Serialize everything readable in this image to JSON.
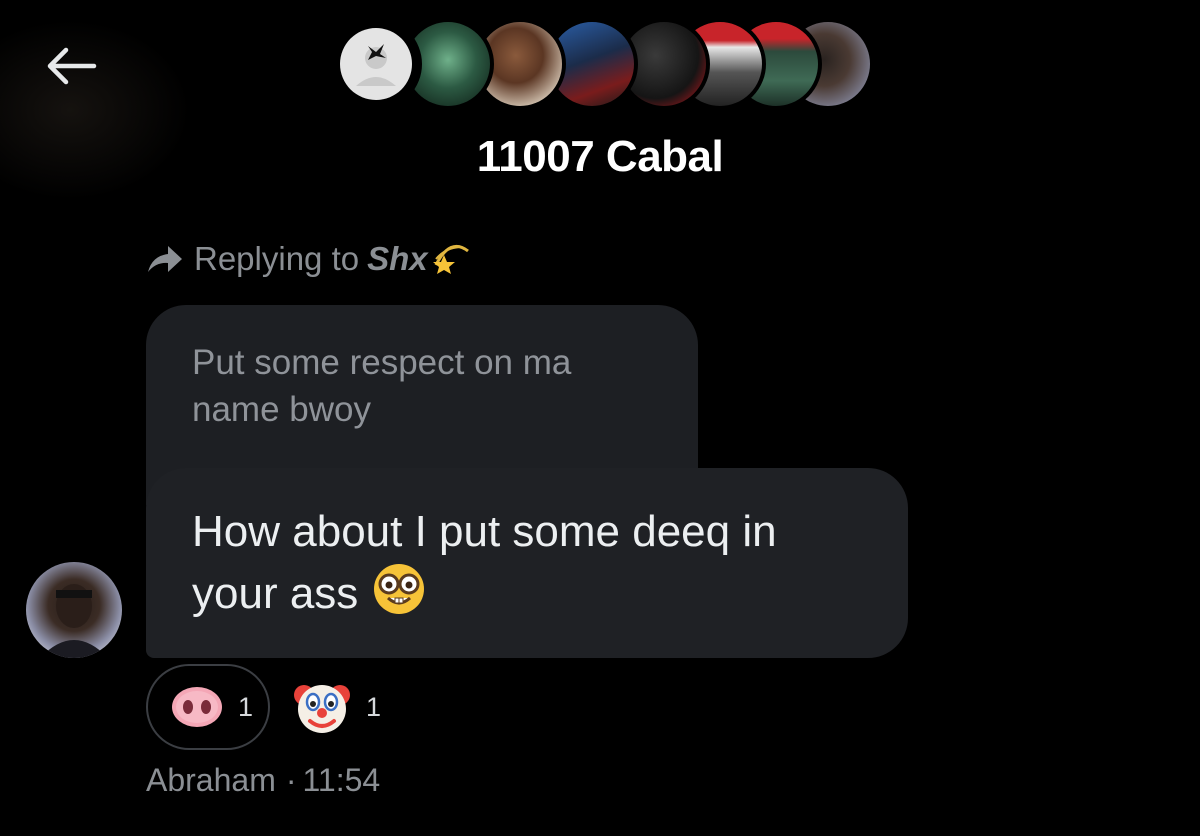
{
  "header": {
    "back_icon": "arrow-left-icon",
    "title": "11007 Cabal",
    "member_avatars": [
      "avatar-1",
      "avatar-2",
      "avatar-3",
      "avatar-4",
      "avatar-5",
      "avatar-6",
      "avatar-7",
      "avatar-8"
    ]
  },
  "reply": {
    "prefix": "Replying to",
    "name": "Shx",
    "icon": "reply-arrow-icon",
    "name_emoji": "dizzy-star-emoji"
  },
  "quoted_message": {
    "line1": "Put some respect on ma",
    "line2": "name bwoy"
  },
  "message": {
    "line1": "How about I put some deeq in",
    "line2": "your ass",
    "emoji": "nerd-face-emoji"
  },
  "reactions": [
    {
      "emoji": "pig-nose-emoji",
      "count": "1",
      "selected": true
    },
    {
      "emoji": "clown-face-emoji",
      "count": "1",
      "selected": false
    }
  ],
  "meta": {
    "sender": "Abraham",
    "separator": "·",
    "time": "11:54"
  },
  "colors": {
    "background": "#000000",
    "bubble": "#1f2125",
    "muted_text": "#8b8f94"
  }
}
